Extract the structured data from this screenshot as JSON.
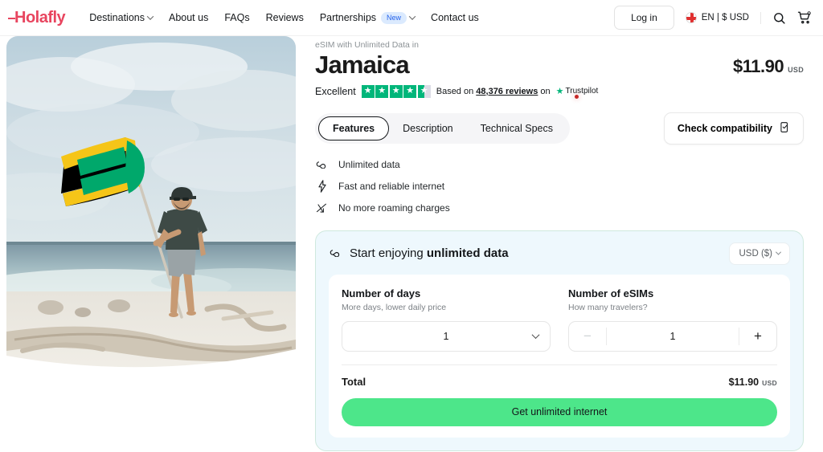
{
  "header": {
    "logo": "Holafly",
    "nav": [
      {
        "label": "Destinations",
        "caret": true,
        "badge": null
      },
      {
        "label": "About us",
        "caret": false,
        "badge": null
      },
      {
        "label": "FAQs",
        "caret": false,
        "badge": null
      },
      {
        "label": "Reviews",
        "caret": false,
        "badge": null
      },
      {
        "label": "Partnerships",
        "caret": true,
        "badge": "New"
      },
      {
        "label": "Contact us",
        "caret": false,
        "badge": null
      }
    ],
    "login_label": "Log in",
    "language": "EN | $ USD",
    "search_icon": "search-icon",
    "cart_icon": "cart-icon",
    "flag_icon": "england-flag-icon"
  },
  "hero": {
    "alt": "Man holding Jamaican flag on a beach"
  },
  "product": {
    "eyebrow": "eSIM with Unlimited Data in",
    "title": "Jamaica",
    "price": "$11.90",
    "currency": "USD"
  },
  "trustpilot": {
    "rating_word": "Excellent",
    "stars": 4.5,
    "based_prefix": "Based on ",
    "reviews_count": "48,376 reviews",
    "on_label": " on ",
    "brand": "Trustpilot",
    "star_color": "#00b67a"
  },
  "tabs": [
    {
      "label": "Features",
      "active": true
    },
    {
      "label": "Description",
      "active": false
    },
    {
      "label": "Technical Specs",
      "active": false
    }
  ],
  "compatibility": {
    "label": "Check compatibility",
    "icon": "device-check-icon"
  },
  "features": [
    {
      "icon": "infinity-icon",
      "glyph": "∞",
      "label": "Unlimited data"
    },
    {
      "icon": "lightning-bolt-icon",
      "glyph": "⚡",
      "label": "Fast and reliable internet"
    },
    {
      "icon": "no-roaming-icon",
      "glyph": "↘",
      "label": "No more roaming charges"
    }
  ],
  "purchase": {
    "card_title_plain": "Start enjoying ",
    "card_title_bold": "unlimited data",
    "card_icon": "infinity-icon",
    "currency_selector": "USD ($)",
    "days": {
      "title": "Number of days",
      "subtitle": "More days, lower daily price",
      "value": "1"
    },
    "esims": {
      "title": "Number of eSIMs",
      "subtitle": "How many travelers?",
      "value": "1",
      "minus": "−",
      "plus": "+",
      "minus_disabled": true
    },
    "total_label": "Total",
    "total_price": "$11.90",
    "total_currency": "USD",
    "cta_label": "Get unlimited internet",
    "cta_color": "#4de68a",
    "card_bg": "#eef8fd",
    "card_border": "#cfe9de"
  }
}
